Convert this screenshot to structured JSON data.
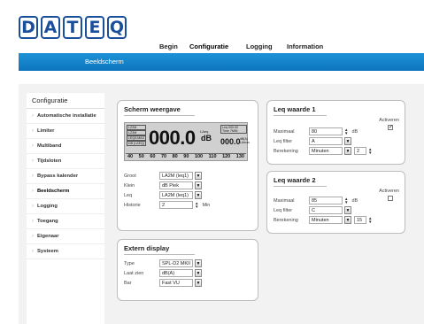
{
  "logo": {
    "letters": [
      "D",
      "A",
      "T",
      "E",
      "Q"
    ]
  },
  "topnav": [
    {
      "label": "Begin"
    },
    {
      "label": "Configuratie"
    },
    {
      "label": "Logging"
    },
    {
      "label": "Information"
    }
  ],
  "banner": {
    "title": "Beeldscherm"
  },
  "sidebar": {
    "title": "Configuratie",
    "items": [
      {
        "label": "Automatische installatie"
      },
      {
        "label": "Limiter"
      },
      {
        "label": "Multiband"
      },
      {
        "label": "Tijdsloten"
      },
      {
        "label": "Bypass kalender"
      },
      {
        "label": "Beeldscherm"
      },
      {
        "label": "Logging"
      },
      {
        "label": "Toegang"
      },
      {
        "label": "Eigenaar"
      },
      {
        "label": "Systeem"
      }
    ],
    "active_index": 5
  },
  "scherm": {
    "title": "Scherm weergave",
    "lcd": {
      "box1": "LZ2M",
      "box2": "LZ3M",
      "box3": "LEQ/LMAX",
      "box4": "DB (LAEQ)",
      "big_value": "000.0",
      "big_unit": "dB",
      "big_label": "LAeq",
      "time_box": "Leq 000.00\nTime 7MIN",
      "small_value": "000.0",
      "small_unit": "dB(A)\nLAmax",
      "scale": [
        "40",
        "50",
        "60",
        "70",
        "80",
        "90",
        "100",
        "110",
        "120",
        "130"
      ]
    },
    "rows": [
      {
        "label": "Groot",
        "value": "LA2M (leq1)"
      },
      {
        "label": "Klein",
        "value": "dB Piek"
      },
      {
        "label": "Leq",
        "value": "LA2M (leq1)"
      },
      {
        "label": "Historie",
        "value": "2",
        "unit": "Min"
      }
    ]
  },
  "extern": {
    "title": "Extern display",
    "rows": [
      {
        "label": "Type",
        "value": "SPL-D2 MKII"
      },
      {
        "label": "Laat zien",
        "value": "dB(A)"
      },
      {
        "label": "Bar",
        "value": "Fast VU"
      }
    ]
  },
  "leq1": {
    "title": "Leq waarde 1",
    "maximaal_label": "Maximaal",
    "maximaal_value": "80",
    "maximaal_unit": "dB",
    "filter_label": "Leq filter",
    "filter_value": "A",
    "berekening_label": "Berekening",
    "berekening_value": "Minuten",
    "berekening_num": "2",
    "activeren_label": "Activeren",
    "activeren_checked": "✓"
  },
  "leq2": {
    "title": "Leq waarde 2",
    "maximaal_label": "Maximaal",
    "maximaal_value": "85",
    "maximaal_unit": "dB",
    "filter_label": "Leq filter",
    "filter_value": "C",
    "berekening_label": "Berekening",
    "berekening_value": "Minuten",
    "berekening_num": "15",
    "activeren_label": "Activeren",
    "activeren_checked": ""
  },
  "colors": {
    "brand_blue": "#1a4f9c",
    "bar_blue": "#1180c8",
    "content_bg": "#f2f2f2"
  }
}
